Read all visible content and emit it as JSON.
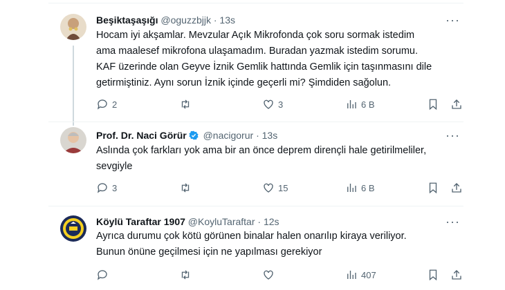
{
  "tweets": [
    {
      "name": "Beşiktaşaşığı",
      "handle": "@oguzzbjjk",
      "time": "13s",
      "verified": false,
      "text_lines": [
        "Hocam iyi akşamlar. Mevzular Açık Mikrofonda çok soru sormak istedim",
        "ama maalesef mikrofona ulaşamadım. Buradan yazmak istedim sorumu.",
        "KAF üzerinde olan Geyve İznik Gemlik hattında Gemlik için taşınmasını dile",
        "getirmiştiniz. Aynı sorun İznik içinde geçerli mi? Şimdiden sağolun."
      ],
      "replies": "2",
      "retweets": "",
      "likes": "3",
      "views": "6 B"
    },
    {
      "name": "Prof. Dr. Naci Görür",
      "handle": "@nacigorur",
      "time": "13s",
      "verified": true,
      "text_lines": [
        "Aslında çok farkları yok ama bir an önce deprem dirençli hale getirilmeliler,",
        "sevgiyle"
      ],
      "replies": "3",
      "retweets": "",
      "likes": "15",
      "views": "6 B"
    },
    {
      "name": "Köylü Taraftar 1907",
      "handle": "@KoyluTaraftar",
      "time": "12s",
      "verified": false,
      "text_lines": [
        "Ayrıca durumu çok kötü görünen binalar halen onarılıp kiraya veriliyor.",
        "Bunun önüne geçilmesi için ne yapılması gerekiyor"
      ],
      "replies": "",
      "retweets": "",
      "likes": "",
      "views": "407"
    }
  ],
  "separator": "·",
  "more_glyph": "···",
  "colors": {
    "text": "#0f1419",
    "secondary": "#536471",
    "verified": "#1d9bf0",
    "divider": "#eff3f4"
  },
  "icons": [
    "reply-icon",
    "retweet-icon",
    "like-icon",
    "views-icon",
    "bookmark-icon",
    "share-icon",
    "more-icon",
    "verified-badge-icon"
  ]
}
